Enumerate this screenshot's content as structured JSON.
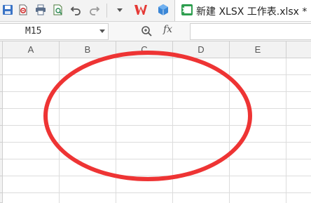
{
  "toolbar": {
    "buttons": [
      {
        "name": "save-icon"
      },
      {
        "name": "export-pdf-icon"
      },
      {
        "name": "print-icon"
      },
      {
        "name": "print-preview-icon"
      },
      {
        "name": "undo-icon"
      },
      {
        "name": "redo-icon"
      },
      {
        "name": "customize-dropdown-icon"
      },
      {
        "name": "wps-logo-icon"
      },
      {
        "name": "cloud-cube-icon"
      }
    ]
  },
  "tab": {
    "title": "新建 XLSX 工作表.xlsx *"
  },
  "formula_bar": {
    "cell_reference": "M15",
    "fx_label": "fx",
    "formula_value": ""
  },
  "sheet": {
    "columns": [
      "A",
      "B",
      "C",
      "D",
      "E"
    ],
    "row_count": 9
  },
  "annotation": {
    "shape": "ellipse",
    "color": "#ee3434"
  }
}
